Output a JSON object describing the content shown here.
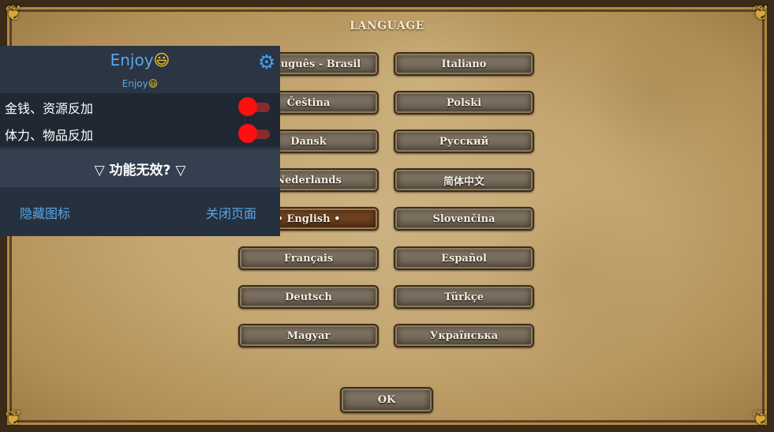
{
  "game": {
    "title": "LANGUAGE",
    "languages_left": [
      "Português - Brasil",
      "Čeština",
      "Dansk",
      "Nederlands",
      "•  English  •",
      "Français",
      "Deutsch",
      "Magyar"
    ],
    "languages_right": [
      "Italiano",
      "Polski",
      "Русский",
      "简体中文",
      "Slovenčina",
      "Español",
      "Türkçe",
      "Українська"
    ],
    "selected": "English",
    "ok_label": "OK"
  },
  "overlay": {
    "title": "Enjoy",
    "title_emoji": "😃",
    "subtitle": "Enjoy",
    "subtitle_emoji": "😃",
    "settings_icon": "gear-icon",
    "toggles": [
      {
        "label": "金钱、资源反加",
        "state": "off"
      },
      {
        "label": "体力、物品反加",
        "state": "off"
      }
    ],
    "not_working_label": "▽ 功能无效? ▽",
    "hide_icon_label": "隐藏图标",
    "close_page_label": "关闭页面",
    "colors": {
      "accent": "#5aa7e6",
      "toggle": "#ff0f0f",
      "panel": "#2a3442"
    }
  }
}
